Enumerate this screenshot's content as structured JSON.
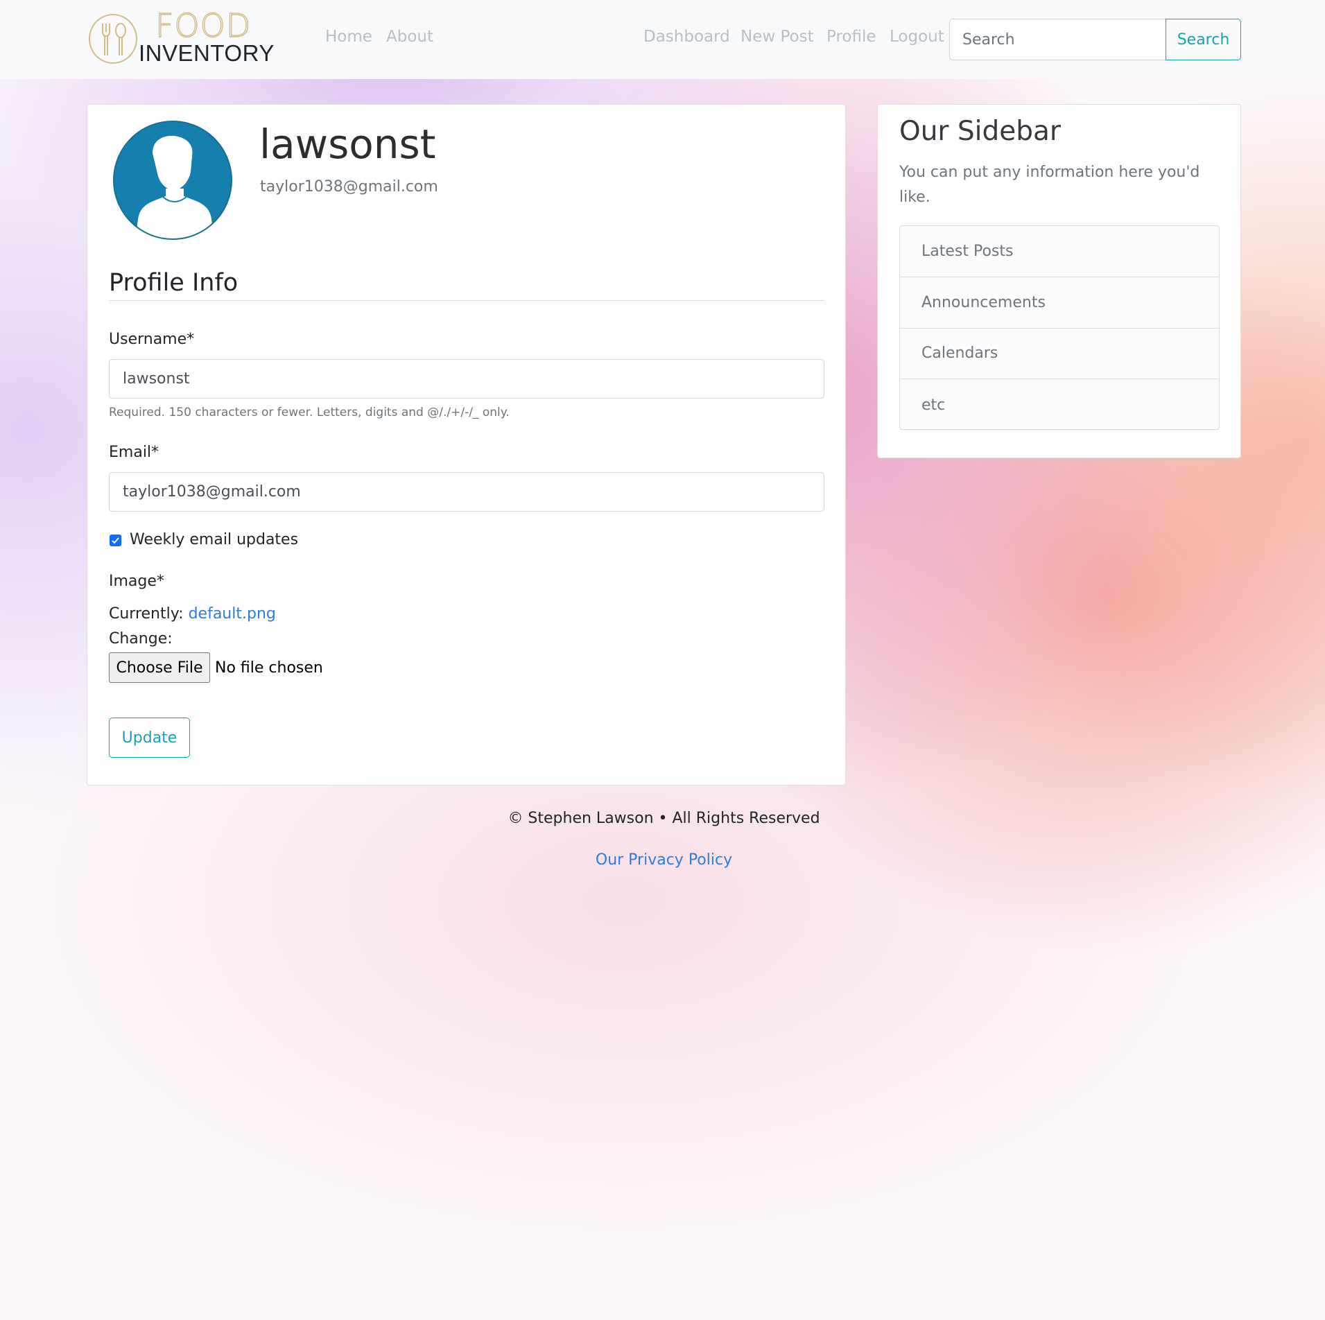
{
  "navbar": {
    "logo_top": "FOOD",
    "logo_bottom": "INVENTORY",
    "left_links": [
      "Home",
      "About"
    ],
    "right_links": [
      "Dashboard",
      "New Post",
      "Profile",
      "Logout"
    ],
    "search_placeholder": "Search",
    "search_button": "Search"
  },
  "profile": {
    "username": "lawsonst",
    "email": "taylor1038@gmail.com",
    "avatar_icon": "user-silhouette-icon"
  },
  "form": {
    "section_title": "Profile Info",
    "username_label": "Username*",
    "username_value": "lawsonst",
    "username_help": "Required. 150 characters or fewer. Letters, digits and @/./+/-/_ only.",
    "email_label": "Email*",
    "email_value": "taylor1038@gmail.com",
    "weekly_updates_label": "Weekly email updates",
    "weekly_updates_checked": true,
    "image_label": "Image*",
    "currently_label": "Currently:",
    "current_file": "default.png",
    "change_label": "Change:",
    "choose_file_button": "Choose File",
    "no_file_text": "No file chosen",
    "update_button": "Update"
  },
  "sidebar": {
    "title": "Our Sidebar",
    "text": "You can put any information here you'd like.",
    "items": [
      "Latest Posts",
      "Announcements",
      "Calendars",
      "etc"
    ]
  },
  "footer": {
    "copyright": "© Stephen Lawson • All Rights Reserved",
    "privacy_link": "Our Privacy Policy"
  },
  "colors": {
    "accent": "#17a2b8",
    "link": "#2f7dd9",
    "avatar_bg": "#157fad",
    "logo_gold": "#d4bd85"
  }
}
